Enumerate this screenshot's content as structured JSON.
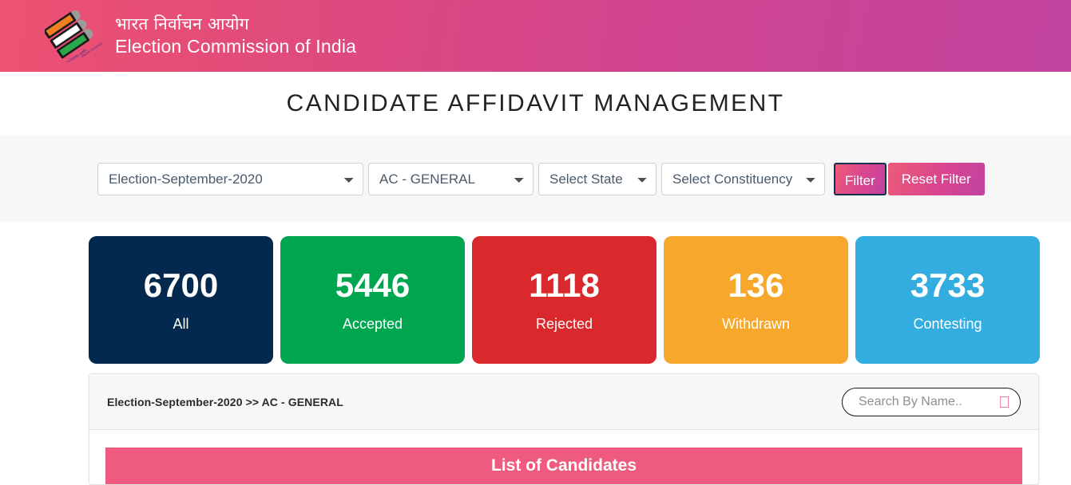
{
  "header": {
    "logo_icon": "eci-ballot-box-logo",
    "brand_hindi": "भारत निर्वाचन आयोग",
    "brand_english": "Election Commission of India",
    "gradient_start": "#ee5272",
    "gradient_end": "#c2449f"
  },
  "page_title": "CANDIDATE AFFIDAVIT MANAGEMENT",
  "filters": {
    "election": {
      "value": "Election-September-2020",
      "icon": "chevron-down-icon"
    },
    "election_type": {
      "value": "AC - GENERAL",
      "icon": "chevron-down-icon"
    },
    "state": {
      "value": "Select State",
      "icon": "chevron-down-icon"
    },
    "constituency": {
      "value": "Select Constituency",
      "icon": "chevron-down-icon"
    },
    "filter_button": "Filter",
    "reset_button": "Reset Filter",
    "button_gradient_start": "#ec5b79",
    "button_gradient_end": "#c043a0",
    "filter_button_focus_border": "#14304d"
  },
  "stats": [
    {
      "value": "6700",
      "label": "All",
      "color": "#04294f"
    },
    {
      "value": "5446",
      "label": "Accepted",
      "color": "#00a550"
    },
    {
      "value": "1118",
      "label": "Rejected",
      "color": "#d9292c"
    },
    {
      "value": "136",
      "label": "Withdrawn",
      "color": "#f7a72b"
    },
    {
      "value": "3733",
      "label": "Contesting",
      "color": "#33ade0"
    }
  ],
  "panel": {
    "breadcrumb": "Election-September-2020 >> AC - GENERAL",
    "search": {
      "placeholder": "Search By Name..",
      "value": "",
      "icon": "search-icon"
    },
    "list_header": "List of Candidates",
    "list_header_color": "#ee5b7e"
  }
}
